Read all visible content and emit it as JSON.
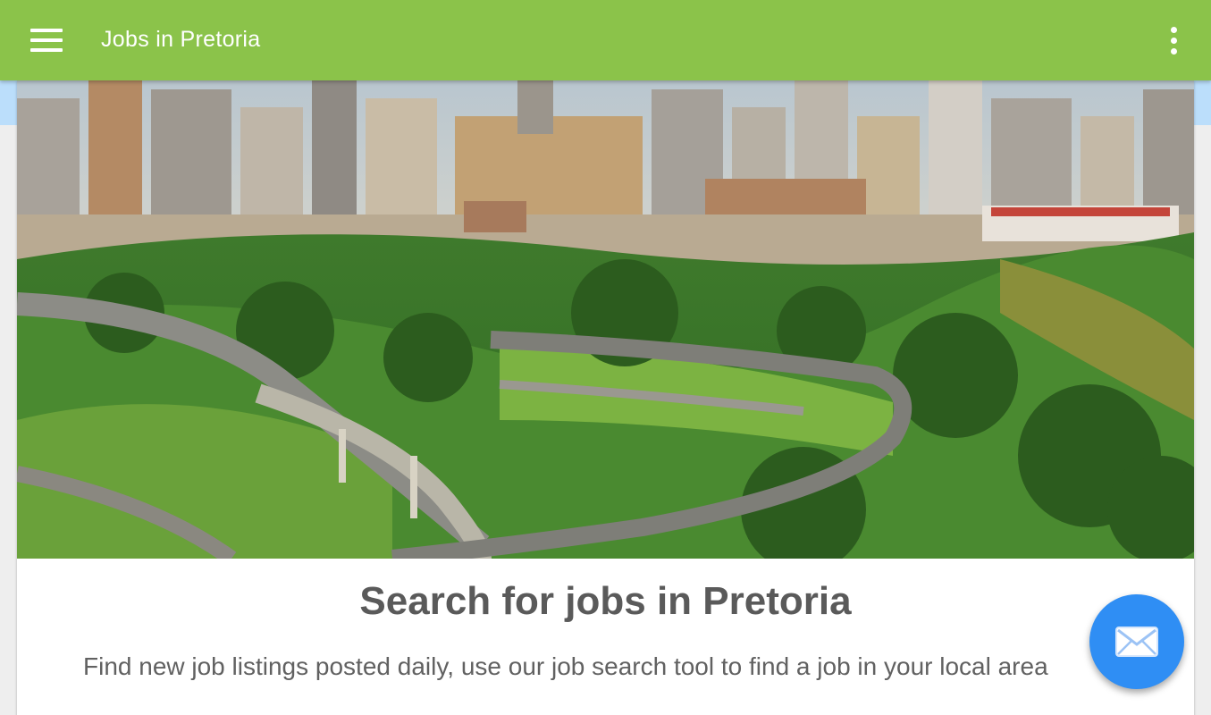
{
  "appbar": {
    "title": "Jobs in Pretoria",
    "menu_icon": "hamburger-menu-icon",
    "overflow_icon": "more-vert-icon",
    "color": "#8bc34a"
  },
  "card": {
    "title": "Search for jobs in Pretoria",
    "description": "Find new job listings posted daily, use our job search tool to find a job in your local area"
  },
  "fab": {
    "icon": "email-icon",
    "color": "#2f8ef4"
  }
}
